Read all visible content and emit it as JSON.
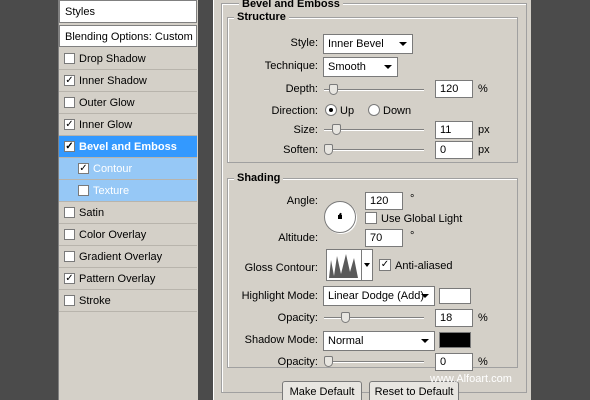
{
  "left_panel": {
    "styles_header": "Styles",
    "blending_options": "Blending Options: Custom",
    "items": [
      {
        "label": "Drop Shadow",
        "checked": false
      },
      {
        "label": "Inner Shadow",
        "checked": true
      },
      {
        "label": "Outer Glow",
        "checked": false
      },
      {
        "label": "Inner Glow",
        "checked": true
      },
      {
        "label": "Bevel and Emboss",
        "checked": true,
        "selected": true
      },
      {
        "label": "Contour",
        "checked": true,
        "sub": true
      },
      {
        "label": "Texture",
        "checked": false,
        "sub": true
      },
      {
        "label": "Satin",
        "checked": false
      },
      {
        "label": "Color Overlay",
        "checked": false
      },
      {
        "label": "Gradient Overlay",
        "checked": false
      },
      {
        "label": "Pattern Overlay",
        "checked": true
      },
      {
        "label": "Stroke",
        "checked": false
      }
    ]
  },
  "panel": {
    "title": "Bevel and Emboss",
    "structure": {
      "title": "Structure",
      "style_label": "Style:",
      "style_value": "Inner Bevel",
      "technique_label": "Technique:",
      "technique_value": "Smooth",
      "depth_label": "Depth:",
      "depth_value": "120",
      "depth_unit": "%",
      "direction_label": "Direction:",
      "direction_up": "Up",
      "direction_down": "Down",
      "direction_selected": "Up",
      "size_label": "Size:",
      "size_value": "11",
      "size_unit": "px",
      "soften_label": "Soften:",
      "soften_value": "0",
      "soften_unit": "px"
    },
    "shading": {
      "title": "Shading",
      "angle_label": "Angle:",
      "angle_value": "120",
      "angle_unit": "°",
      "global_light_label": "Use Global Light",
      "global_light_checked": false,
      "altitude_label": "Altitude:",
      "altitude_value": "70",
      "altitude_unit": "°",
      "gloss_contour_label": "Gloss Contour:",
      "anti_aliased_label": "Anti-aliased",
      "anti_aliased_checked": true,
      "highlight_mode_label": "Highlight Mode:",
      "highlight_mode_value": "Linear Dodge (Add)",
      "highlight_color": "#ffffff",
      "highlight_opacity_label": "Opacity:",
      "highlight_opacity_value": "18",
      "highlight_opacity_unit": "%",
      "shadow_mode_label": "Shadow Mode:",
      "shadow_mode_value": "Normal",
      "shadow_color": "#000000",
      "shadow_opacity_label": "Opacity:",
      "shadow_opacity_value": "0",
      "shadow_opacity_unit": "%"
    },
    "buttons": {
      "make_default": "Make Default",
      "reset_default": "Reset to Default"
    }
  },
  "watermark": "www.Alfoart.com",
  "colors": {
    "selected": "#3399ff",
    "sub_selected": "#96c8f6",
    "panel_bg": "#d4d0c8"
  }
}
